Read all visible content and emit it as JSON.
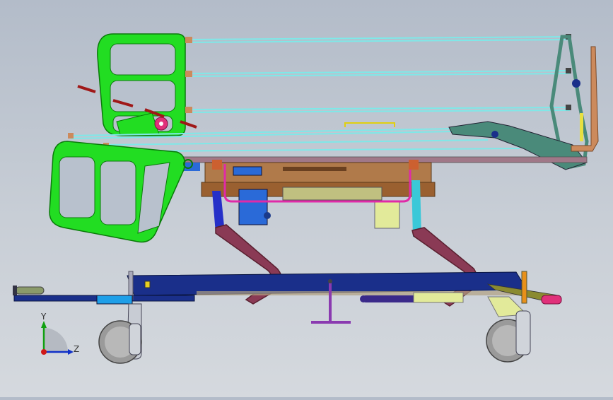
{
  "view": {
    "title": "",
    "colors": {
      "background_top": "#b3bcc9",
      "background_bottom": "#d5d9de",
      "rail_green": "#22dd22",
      "frame_blue": "#1a2f8a",
      "arm_maroon": "#8a3a55",
      "handle_pink": "#e02aa8",
      "copper": "#cc8a5c",
      "cyan_wire": "#7fe8e8",
      "teal_frame": "#4a8a7a",
      "yellow_cylinder": "#e2ea9a",
      "motor_blue": "#2a6ad8",
      "tan_panel": "#b07a4a"
    }
  },
  "triad": {
    "y_label": "Y",
    "z_label": "Z",
    "icon": "coordinate-triad-icon"
  },
  "parts": {
    "head_rail": "green-side-rail",
    "foot_rail": "green-foot-rail",
    "base_frame": "blue-base-frame",
    "casters": "caster-wheel-icon",
    "lift_arms": "maroon-lift-arm",
    "hand_push_bar": "pink-push-handle",
    "actuator": "yellow-actuator"
  }
}
